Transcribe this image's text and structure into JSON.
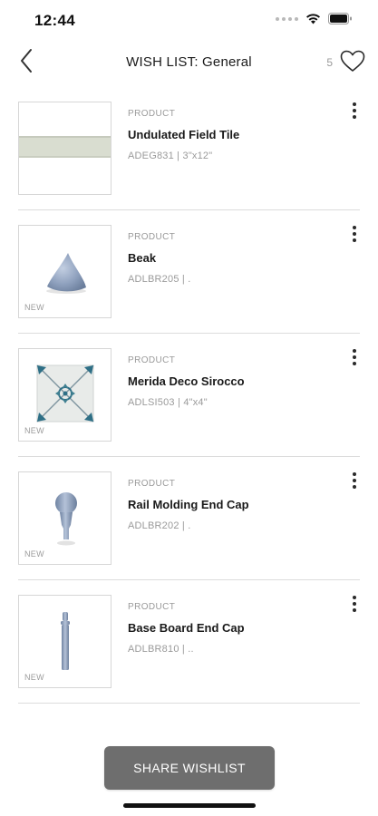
{
  "status_bar": {
    "time": "12:44"
  },
  "header": {
    "title": "WISH LIST: General",
    "count": "5",
    "back_icon": "chevron-left-icon",
    "heart_icon": "heart-outline-icon"
  },
  "items": [
    {
      "kind": "PRODUCT",
      "name": "Undulated Field Tile",
      "meta": "ADEG831 | 3\"x12\"",
      "badge": ""
    },
    {
      "kind": "PRODUCT",
      "name": "Beak",
      "meta": "ADLBR205 | .",
      "badge": "NEW"
    },
    {
      "kind": "PRODUCT",
      "name": "Merida Deco Sirocco",
      "meta": "ADLSI503 | 4\"x4\"",
      "badge": "NEW"
    },
    {
      "kind": "PRODUCT",
      "name": "Rail Molding End Cap",
      "meta": "ADLBR202 | .",
      "badge": "NEW"
    },
    {
      "kind": "PRODUCT",
      "name": "Base Board End Cap",
      "meta": "ADLBR810 | ..",
      "badge": "NEW"
    }
  ],
  "footer": {
    "share_label": "SHARE WISHLIST"
  },
  "colors": {
    "button_bg": "#6e6e6e",
    "tile_blue": "#8ea0bd",
    "muted_text": "#9a9a9a"
  }
}
